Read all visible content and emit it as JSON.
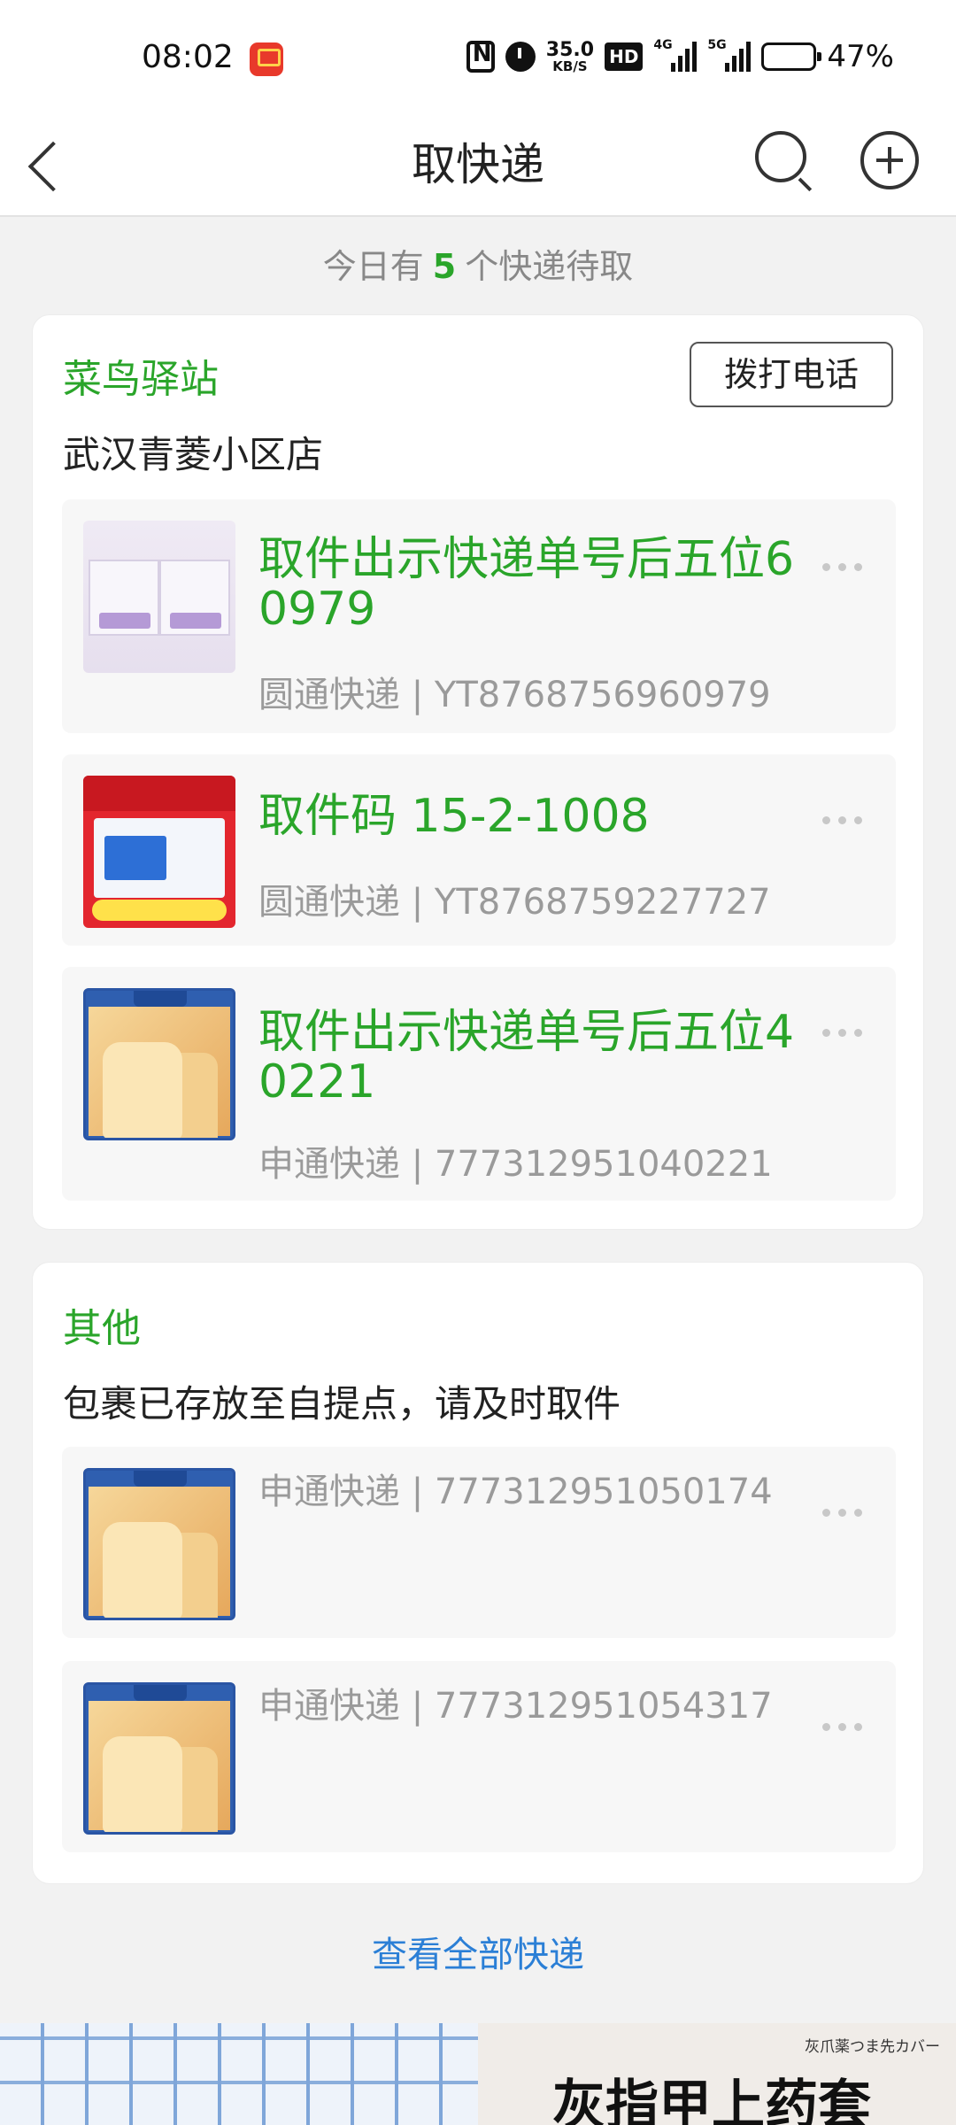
{
  "status_bar": {
    "time": "08:02",
    "net_speed_value": "35.0",
    "net_speed_unit": "KB/S",
    "hd_label": "HD",
    "sim1_label": "4G",
    "sim2_label": "5G",
    "battery_percent": "47%",
    "battery_level": 0.47
  },
  "header": {
    "title": "取快递"
  },
  "summary": {
    "prefix": "今日有",
    "count": "5",
    "suffix": "个快递待取"
  },
  "station": {
    "name": "菜鸟驿站",
    "call_button": "拨打电话",
    "location": "武汉青菱小区店",
    "packages": [
      {
        "pickup": "取件出示快递单号后五位60979",
        "tracking": "圆通快递 | YT8768756960979"
      },
      {
        "pickup": "取件码 15-2-1008",
        "tracking": "圆通快递 | YT8768759227727"
      },
      {
        "pickup": "取件出示快递单号后五位40221",
        "tracking": "申通快递 | 777312951040221"
      }
    ]
  },
  "other": {
    "title": "其他",
    "subtitle": "包裹已存放至自提点，请及时取件",
    "packages": [
      {
        "tracking": "申通快递 | 777312951050174"
      },
      {
        "tracking": "申通快递 | 777312951054317"
      }
    ]
  },
  "view_all": "查看全部快递",
  "banner": {
    "small_text": "灰爪薬つま先カバー",
    "big_text": "灰指甲上药套"
  },
  "colors": {
    "accent_green": "#2aa52a",
    "link_blue": "#2b7fd6",
    "muted_gray": "#9a9a9a"
  }
}
